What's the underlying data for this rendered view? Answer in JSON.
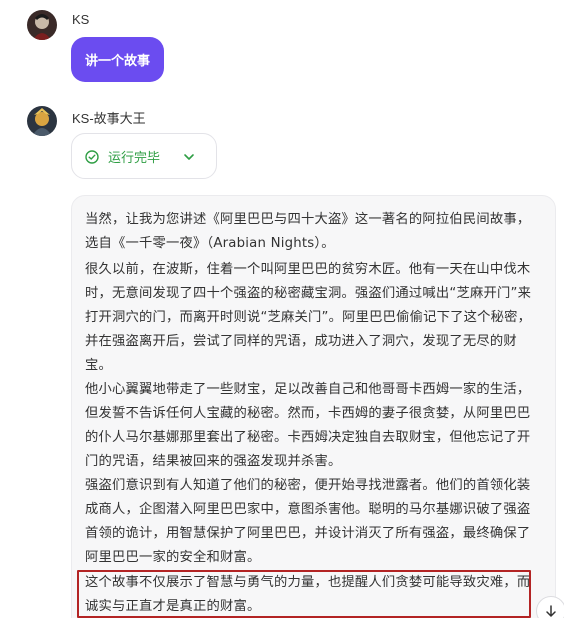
{
  "user": {
    "name": "KS",
    "message": "讲一个故事"
  },
  "bot": {
    "name": "KS-故事大王",
    "status": "运行完毕",
    "paragraphs": [
      "当然，让我为您讲述《阿里巴巴与四十大盗》这一著名的阿拉伯民间故事，选自《一千零一夜》（Arabian Nights）。",
      "很久以前，在波斯，住着一个叫阿里巴巴的贫穷木匠。他有一天在山中伐木时，无意间发现了四十个强盗的秘密藏宝洞。强盗们通过喊出“芝麻开门”来打开洞穴的门，而离开时则说“芝麻关门”。阿里巴巴偷偷记下了这个秘密，并在强盗离开后，尝试了同样的咒语，成功进入了洞穴，发现了无尽的财宝。",
      "他小心翼翼地带走了一些财宝，足以改善自己和他哥哥卡西姆一家的生活，但发誓不告诉任何人宝藏的秘密。然而，卡西姆的妻子很贪婪，从阿里巴巴的仆人马尔基娜那里套出了秘密。卡西姆决定独自去取财宝，但他忘记了开门的咒语，结果被回来的强盗发现并杀害。",
      "强盗们意识到有人知道了他们的秘密，便开始寻找泄露者。他们的首领化装成商人，企图潜入阿里巴巴家中，意图杀害他。聪明的马尔基娜识破了强盗首领的诡计，用智慧保护了阿里巴巴，并设计消灭了所有强盗，最终确保了阿里巴巴一家的安全和财富。",
      "这个故事不仅展示了智慧与勇气的力量，也提醒人们贪婪可能导致灾难，而诚实与正直才是真正的财富。"
    ]
  },
  "colors": {
    "accent": "#6b4cf0",
    "status_green": "#2f9e44",
    "highlight_border": "#b32424"
  },
  "icons": {
    "status": "check-circle-icon",
    "expand": "chevron-down-icon",
    "scroll": "arrow-down-icon"
  }
}
